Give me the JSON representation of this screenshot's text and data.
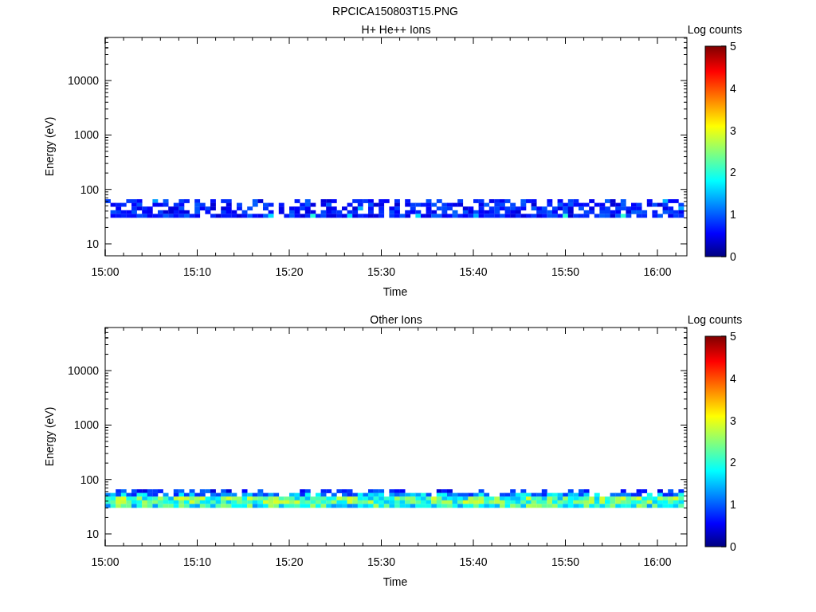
{
  "title": "RPCICA150803T15.PNG",
  "panels": [
    {
      "title": "H+ He++ Ions",
      "ylabel": "Energy (eV)",
      "xlabel": "Time",
      "yticks": [
        "10000",
        "1000",
        "100",
        "10"
      ],
      "xticks": [
        "15:00",
        "15:10",
        "15:20",
        "15:30",
        "15:40",
        "15:50",
        "16:00"
      ],
      "colorbar": {
        "label": "Log counts",
        "ticks": [
          "5",
          "4",
          "3",
          "2",
          "1",
          "0"
        ]
      }
    },
    {
      "title": "Other Ions",
      "ylabel": "Energy (eV)",
      "xlabel": "Time",
      "yticks": [
        "10000",
        "1000",
        "100",
        "10"
      ],
      "xticks": [
        "15:00",
        "15:10",
        "15:20",
        "15:30",
        "15:40",
        "15:50",
        "16:00"
      ],
      "colorbar": {
        "label": "Log counts",
        "ticks": [
          "5",
          "4",
          "3",
          "2",
          "1",
          "0"
        ]
      }
    }
  ]
}
